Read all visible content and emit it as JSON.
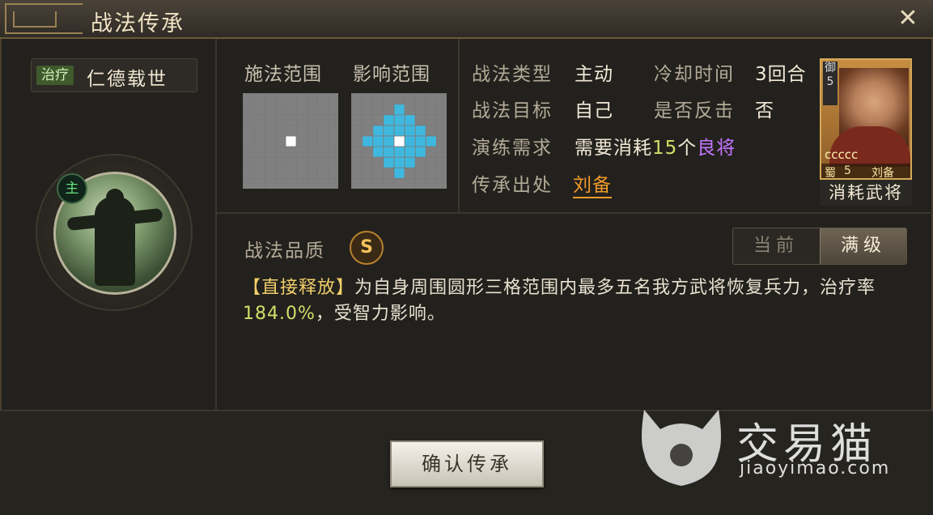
{
  "window": {
    "title": "战法传承",
    "close_icon": "close-icon"
  },
  "skill": {
    "type_tag": "治疗",
    "name": "仁德载世",
    "main_badge": "主"
  },
  "ranges": {
    "cast_label": "施法范围",
    "effect_label": "影响范围",
    "colors": {
      "grid": "#7a7a7a",
      "cell": "#808080",
      "center": "#ffffff",
      "effect": "#3fb8e0"
    }
  },
  "info": {
    "type_label": "战法类型",
    "type_value": "主动",
    "cooldown_label": "冷却时间",
    "cooldown_value": "3回合",
    "target_label": "战法目标",
    "target_value": "自己",
    "counter_label": "是否反击",
    "counter_value": "否",
    "req_label": "演练需求",
    "req_prefix": "需要消耗",
    "req_count": "15",
    "req_unit": "个",
    "req_item": "良将",
    "origin_label": "传承出处",
    "origin_value": "刘备"
  },
  "hero_card": {
    "rank_char": "御",
    "rank_num": "5",
    "stars": "ccccc",
    "faction": "蜀",
    "level": "5",
    "name": "刘备",
    "consume_label": "消耗武将"
  },
  "quality": {
    "label": "战法品质",
    "grade": "S"
  },
  "toggle": {
    "current": "当前",
    "max": "满级"
  },
  "description": {
    "keyword": "【直接释放】",
    "text1": "为自身周围圆形三格范围内最多五名我方武将恢复兵力，治疗率",
    "rate": "184.0%",
    "text2": "，受智力影响。"
  },
  "confirm_button": "确认传承",
  "watermark": {
    "text": "交易猫",
    "url": "jiaoyimao.com"
  }
}
